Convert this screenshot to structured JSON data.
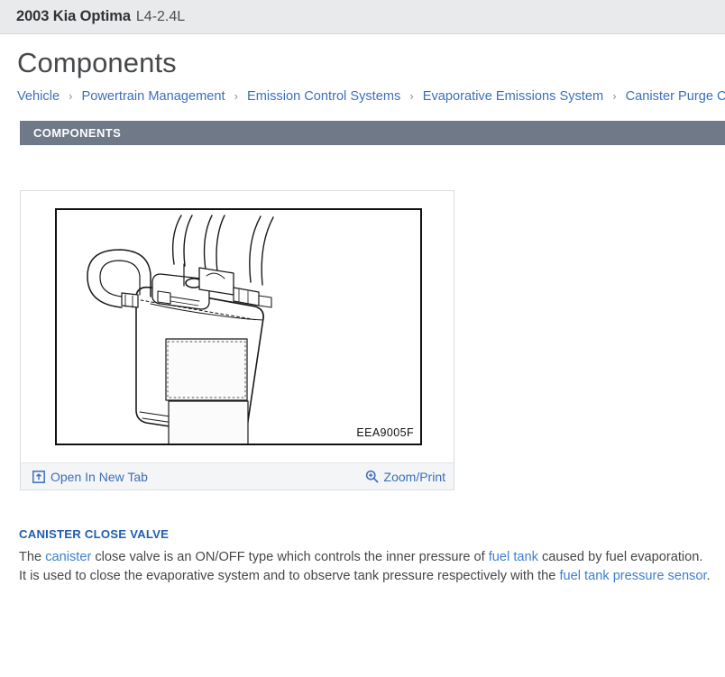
{
  "vehicle": {
    "name": "2003 Kia Optima",
    "engine": "L4-2.4L"
  },
  "page_title": "Components",
  "breadcrumb": {
    "separator": "›",
    "items": [
      "Vehicle",
      "Powertrain Management",
      "Emission Control Systems",
      "Evaporative Emissions System",
      "Canister Purge Control V"
    ]
  },
  "section": {
    "label": "COMPONENTS"
  },
  "figure": {
    "code": "EEA9005F",
    "open_new_tab_label": "Open In New Tab",
    "zoom_print_label": "Zoom/Print",
    "open_new_tab_icon": "open-in-new-tab-icon",
    "zoom_print_icon": "magnifier-plus-icon"
  },
  "article": {
    "heading": "CANISTER CLOSE VALVE",
    "line1": {
      "a": "The ",
      "link1": "canister",
      "b": " close valve is an ON/OFF type which controls the inner pressure of ",
      "link2": "fuel tank",
      "c": " caused by fuel evaporation."
    },
    "line2": {
      "a": "It is used to close the evaporative system and to observe tank pressure respectively with the ",
      "link1": "fuel tank pressure sensor",
      "b": "."
    }
  },
  "colors": {
    "link": "#3c7fd0",
    "breadcrumb_link": "#3c6fba",
    "section_bar": "#6f7988",
    "heading": "#1f5fad",
    "vehicle_bar": "#e9eaeb"
  }
}
